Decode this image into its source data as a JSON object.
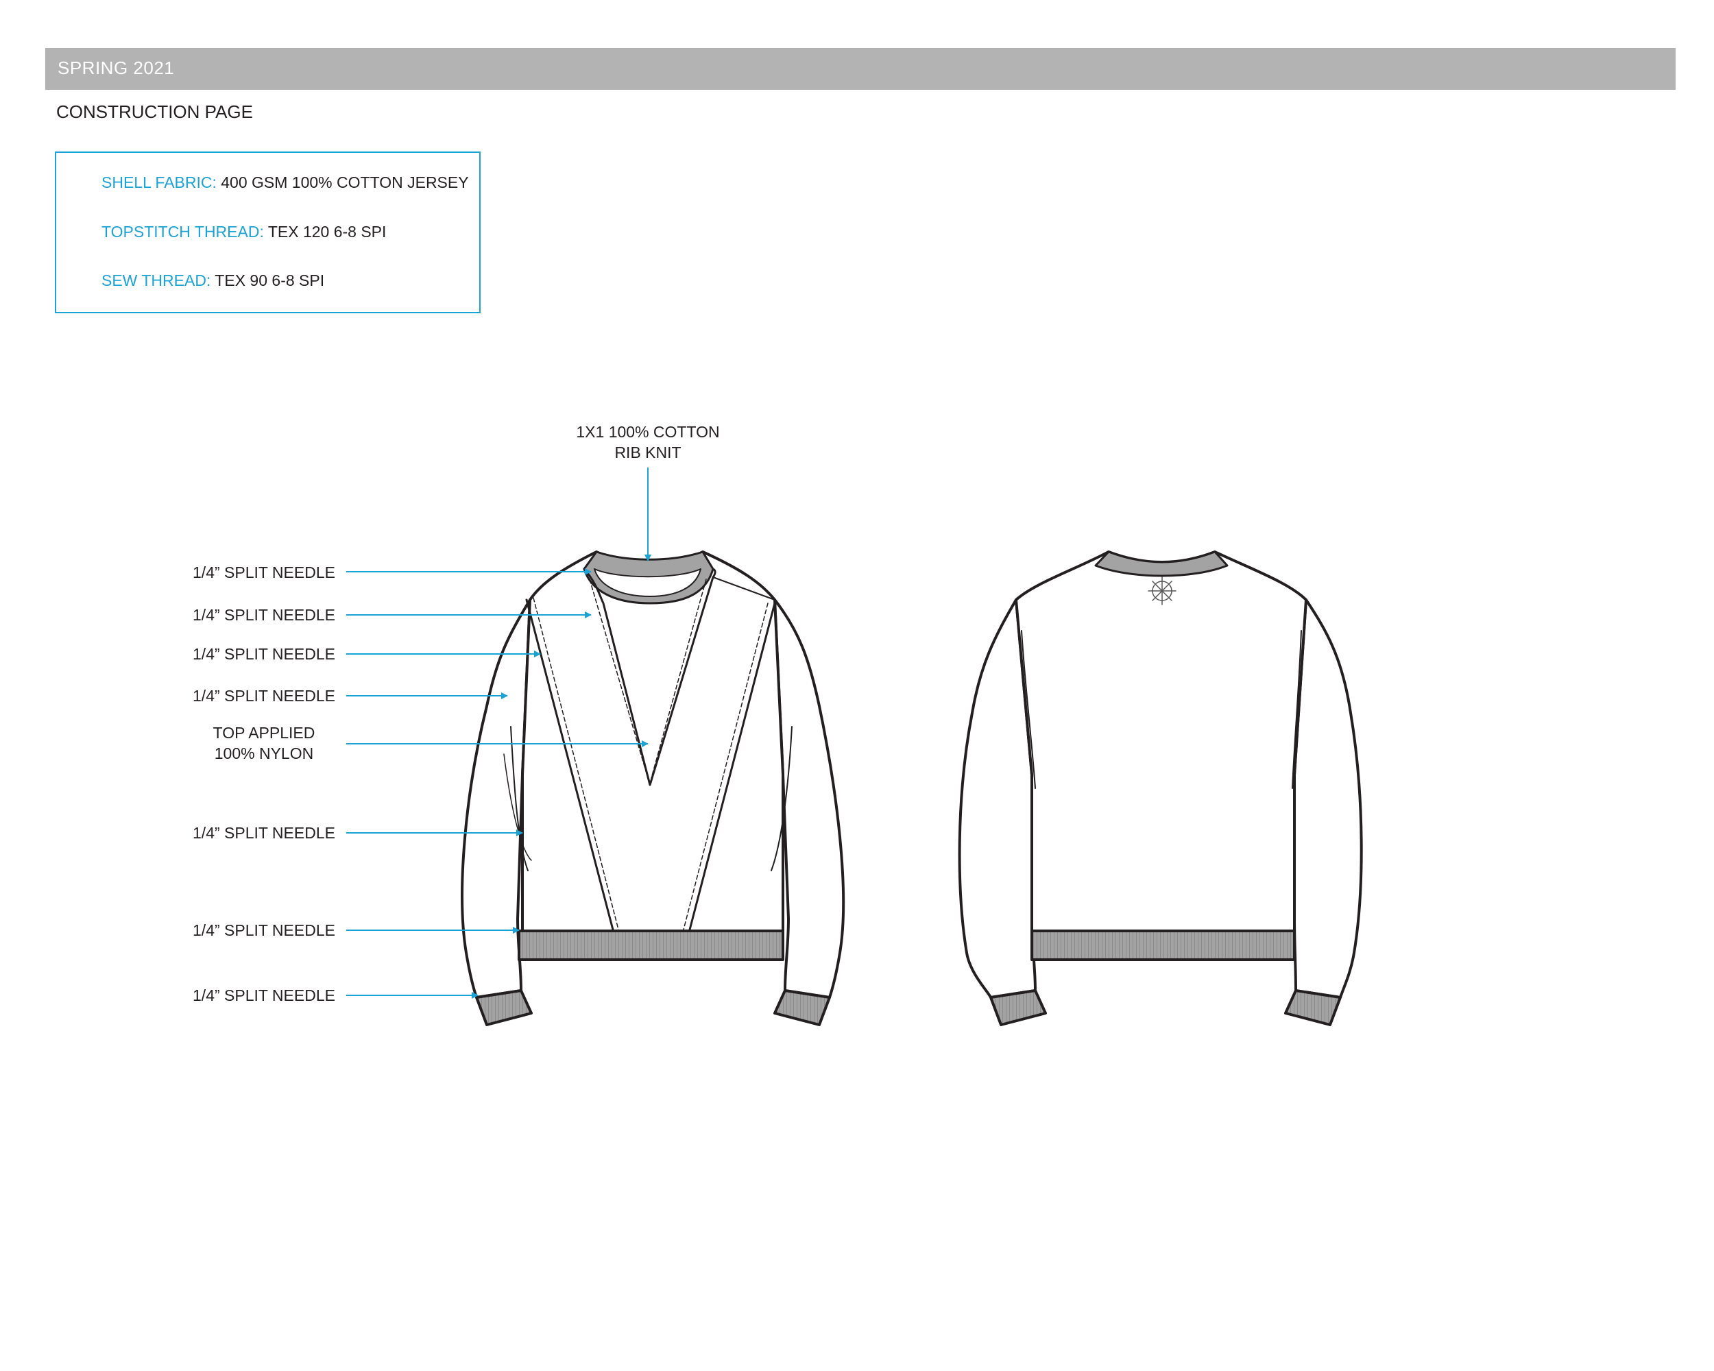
{
  "header": {
    "season": "SPRING 2021",
    "page_title": "CONSTRUCTION PAGE"
  },
  "specs": [
    {
      "key": "SHELL FABRIC:",
      "value": " 400 GSM 100% COTTON JERSEY"
    },
    {
      "key": "TOPSTITCH THREAD:",
      "value": " TEX 120 6-8 SPI"
    },
    {
      "key": "SEW THREAD:",
      "value": " TEX 90 6-8 SPI"
    }
  ],
  "callouts": {
    "rib_line1": "1X1 100% COTTON",
    "rib_line2": "RIB KNIT",
    "split_needle": "1/4” SPLIT NEEDLE",
    "nylon_line1": "TOP APPLIED",
    "nylon_line2": "100% NYLON"
  },
  "colors": {
    "accent": "#1ba3d6",
    "header_bar": "#b3b3b3",
    "rib_gray": "#9d9d9d",
    "outline": "#231f20"
  }
}
